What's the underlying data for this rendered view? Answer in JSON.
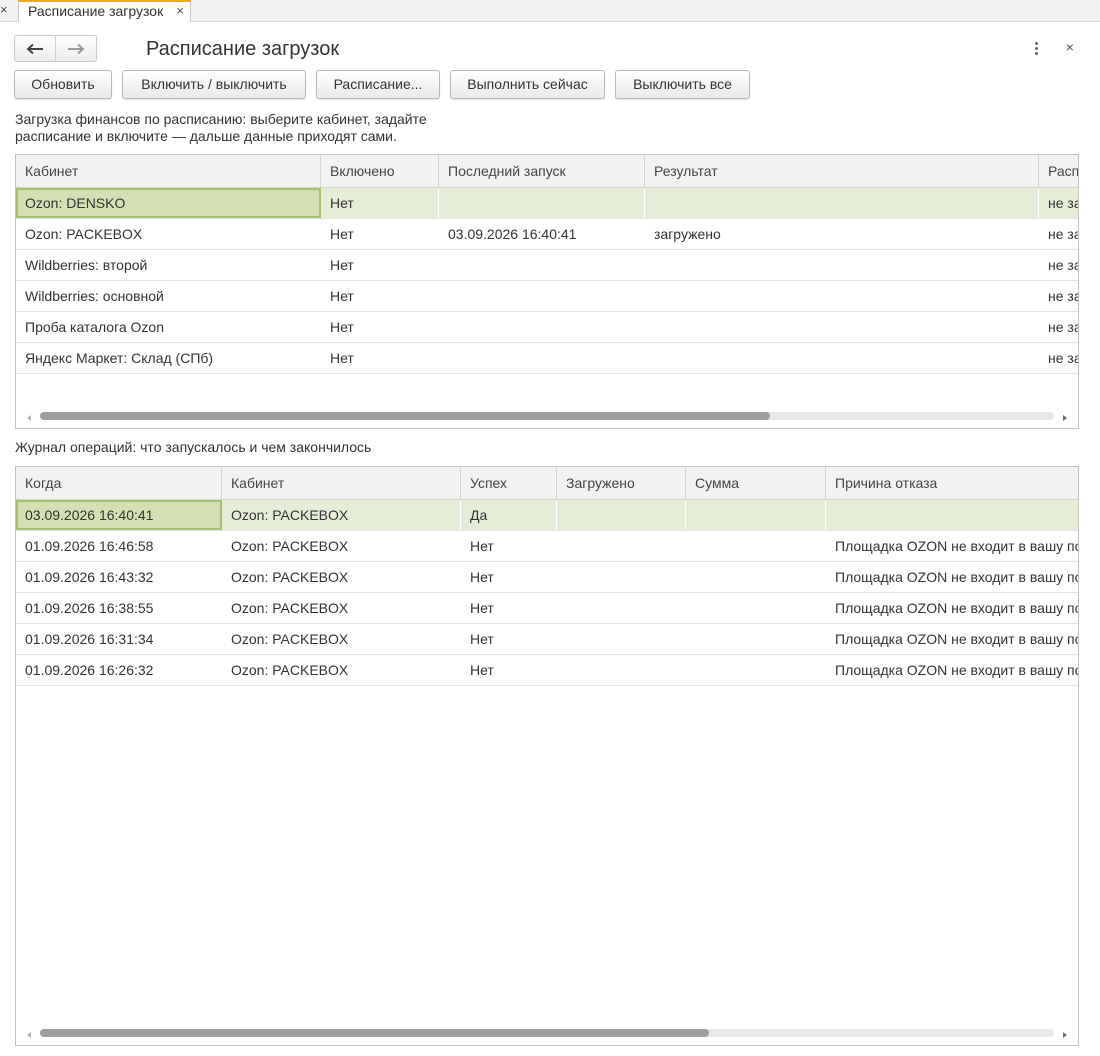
{
  "tabbar": {
    "close_left": "×",
    "tab_label": "Расписание загрузок",
    "tab_close": "×"
  },
  "header": {
    "title": "Расписание загрузок",
    "back_icon": "arrow-left-icon",
    "forward_icon": "arrow-right-icon",
    "menu_icon": "more-vertical-icon",
    "close": "×"
  },
  "toolbar": {
    "refresh": "Обновить",
    "toggle": "Включить / выключить",
    "schedule": "Расписание...",
    "run_now": "Выполнить сейчас",
    "disable_all": "Выключить все"
  },
  "description": "Загрузка финансов по расписанию: выберите кабинет, задайте расписание и включите — дальше данные приходят сами.",
  "cabinets": {
    "columns": [
      "Кабинет",
      "Включено",
      "Последний запуск",
      "Результат",
      "Расписание"
    ],
    "rows": [
      [
        "Ozon: DENSKO",
        "Нет",
        "",
        "",
        "не задано"
      ],
      [
        "Ozon: PACKEBOX",
        "Нет",
        "03.09.2026 16:40:41",
        "загружено",
        "не задано"
      ],
      [
        "Wildberries: второй",
        "Нет",
        "",
        "",
        "не задано"
      ],
      [
        "Wildberries: основной",
        "Нет",
        "",
        "",
        "не задано"
      ],
      [
        "Проба каталога Ozon",
        "Нет",
        "",
        "",
        "не задано"
      ],
      [
        "Яндекс Маркет: Склад (СПб)",
        "Нет",
        "",
        "",
        "не задано"
      ]
    ],
    "selected_row": 0,
    "scroll_position": 0.72
  },
  "journal": {
    "caption": "Журнал операций: что запускалось и чем закончилось",
    "columns": [
      "Когда",
      "Кабинет",
      "Успех",
      "Загружено",
      "Сумма",
      "Причина отказа"
    ],
    "rows": [
      [
        "03.09.2026 16:40:41",
        "Ozon: PACKEBOX",
        "Да",
        "",
        "",
        ""
      ],
      [
        "01.09.2026 16:46:58",
        "Ozon: PACKEBOX",
        "Нет",
        "",
        "",
        "Площадка OZON не входит в вашу подписку"
      ],
      [
        "01.09.2026 16:43:32",
        "Ozon: PACKEBOX",
        "Нет",
        "",
        "",
        "Площадка OZON не входит в вашу подписку"
      ],
      [
        "01.09.2026 16:38:55",
        "Ozon: PACKEBOX",
        "Нет",
        "",
        "",
        "Площадка OZON не входит в вашу подписку"
      ],
      [
        "01.09.2026 16:31:34",
        "Ozon: PACKEBOX",
        "Нет",
        "",
        "",
        "Площадка OZON не входит в вашу подписку"
      ],
      [
        "01.09.2026 16:26:32",
        "Ozon: PACKEBOX",
        "Нет",
        "",
        "",
        "Площадка OZON не входит в вашу подписку"
      ]
    ],
    "selected_row": 0,
    "scroll_position": 0.66
  },
  "colors": {
    "tab_accent": "#f7a600",
    "selected_row": "#e6edd7",
    "current_cell": "#d4e0b1",
    "current_cell_border": "#a5c169"
  }
}
